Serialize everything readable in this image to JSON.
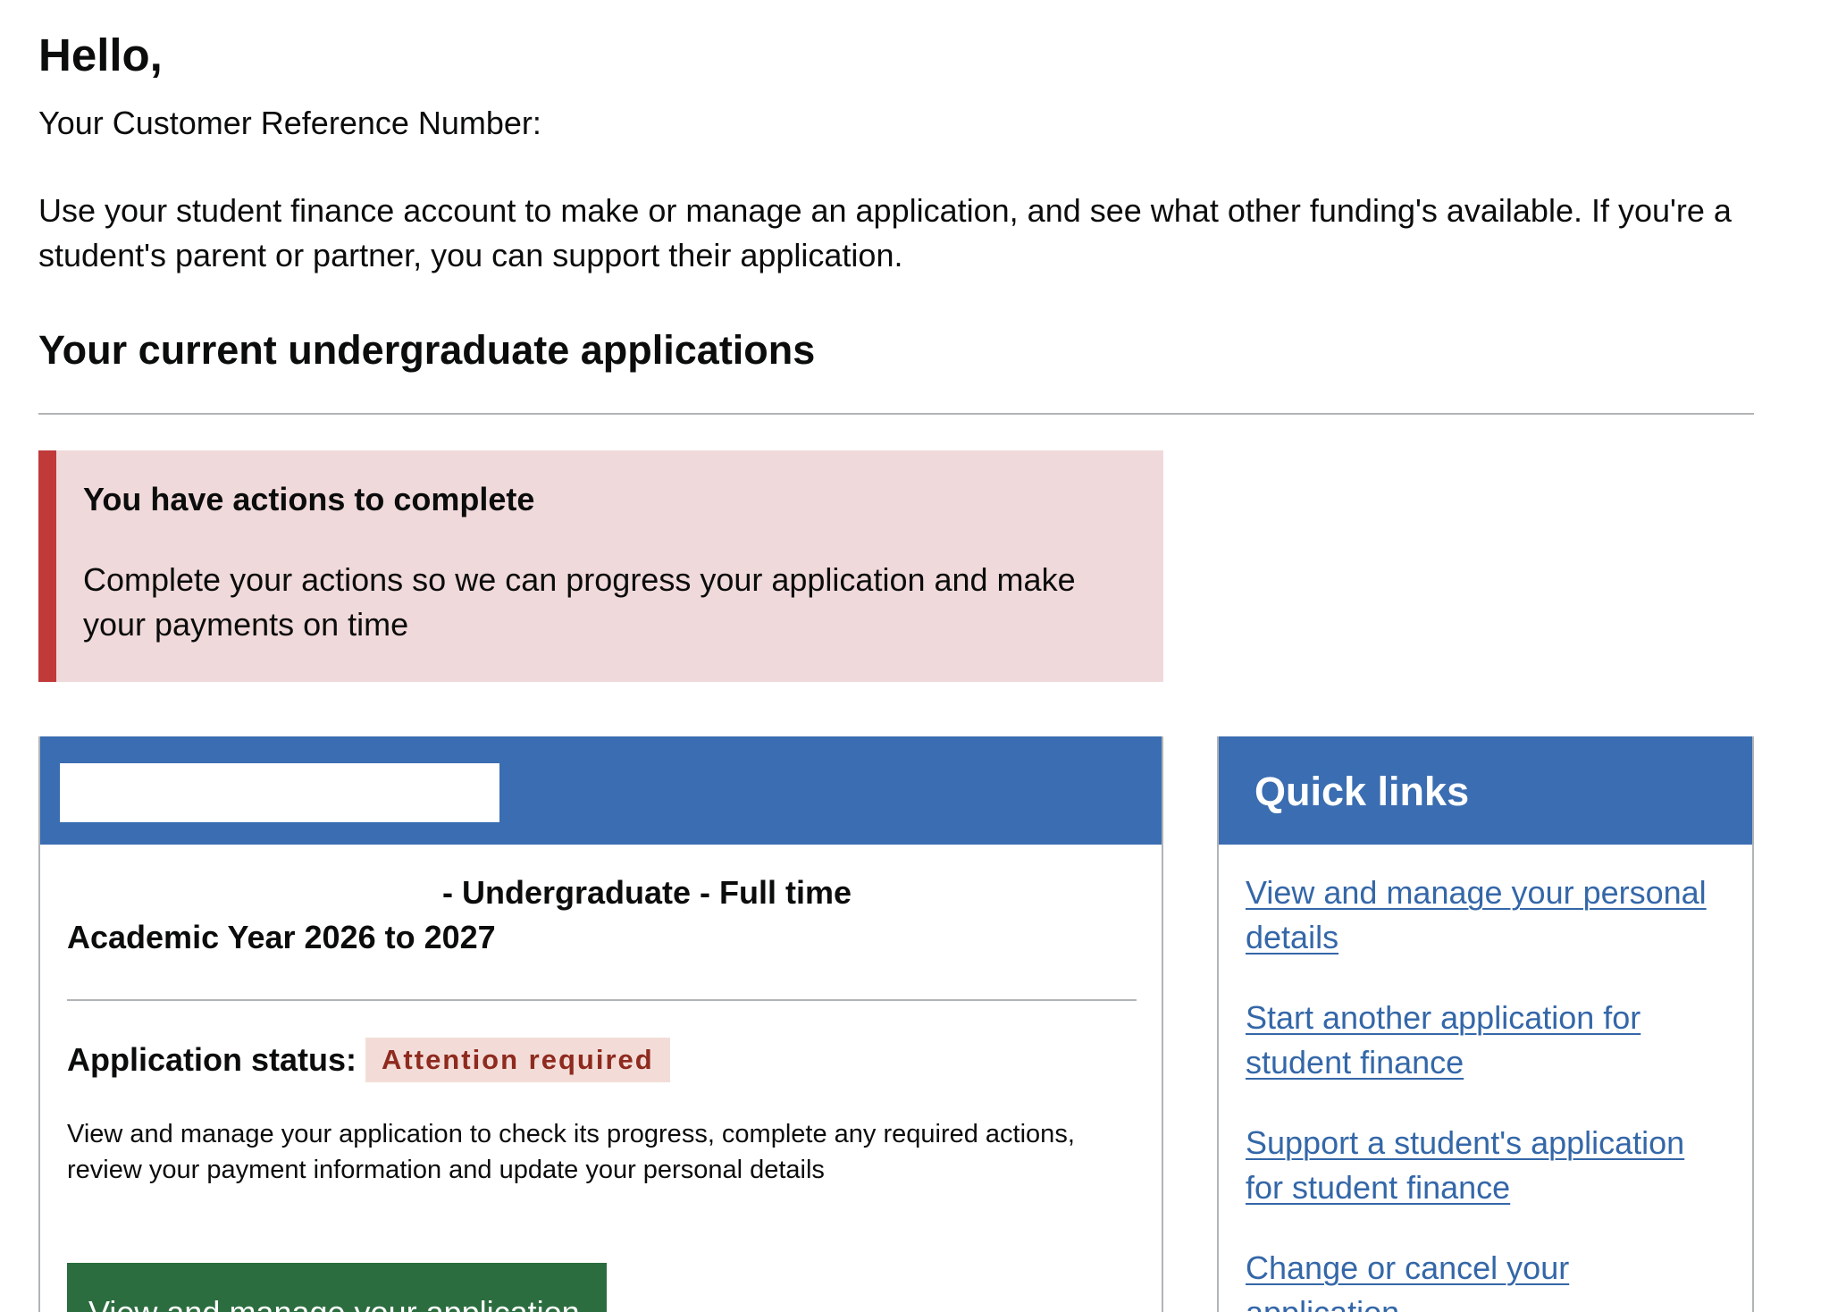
{
  "header": {
    "greeting": "Hello,",
    "customer_reference_label": "Your Customer Reference Number:",
    "intro": "Use your student finance account to make or manage an application, and see what other funding's available. If you're a student's parent or partner, you can support their application."
  },
  "applications": {
    "heading": "Your current undergraduate applications"
  },
  "notice": {
    "title": "You have actions to complete",
    "body": "Complete your actions so we can progress your application and make your payments on time"
  },
  "application_card": {
    "course_suffix": "- Undergraduate - Full time",
    "academic_year": "Academic Year 2026 to 2027",
    "status_label": "Application status:",
    "status_value": "Attention required",
    "description": "View and manage your application to check its progress, complete any required actions, review your payment information and update your personal details",
    "button_label": "View and manage your application"
  },
  "quick_links": {
    "title": "Quick links",
    "items": [
      {
        "label": "View and manage your personal details"
      },
      {
        "label": "Start another application for student finance"
      },
      {
        "label": "Support a student's application for student finance"
      },
      {
        "label": "Change or cancel your application"
      }
    ]
  },
  "colors": {
    "card_header": "#3a6db1",
    "notice_bar": "#c03a3a",
    "notice_bg": "#f0d9da",
    "status_tag_bg": "#f3dcd8",
    "status_tag_text": "#8e2a1e",
    "primary_button": "#2b6d3f",
    "link": "#3467a8"
  }
}
